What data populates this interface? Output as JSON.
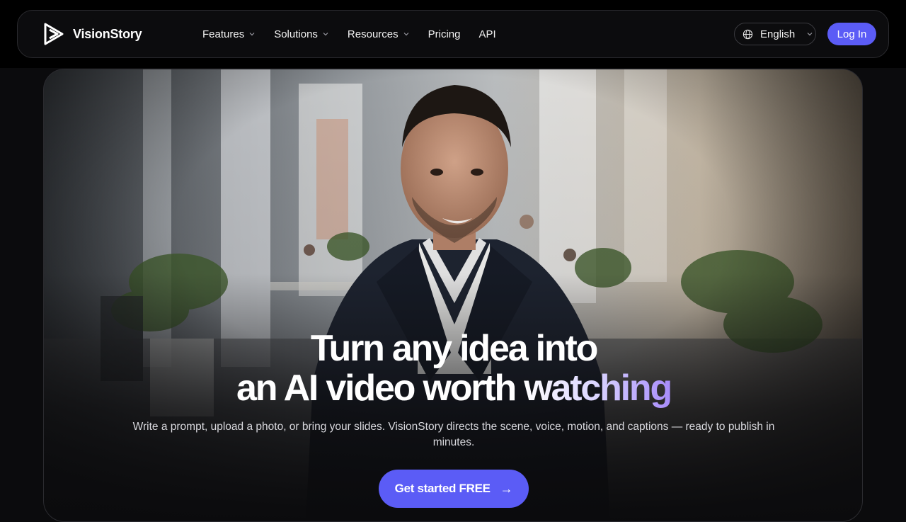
{
  "brand": {
    "name": "VisionStory",
    "logo_icon": "play-triangle-logo"
  },
  "nav": {
    "items": [
      {
        "label": "Features",
        "has_dropdown": true
      },
      {
        "label": "Solutions",
        "has_dropdown": true
      },
      {
        "label": "Resources",
        "has_dropdown": true
      },
      {
        "label": "Pricing",
        "has_dropdown": false
      },
      {
        "label": "API",
        "has_dropdown": false
      }
    ]
  },
  "language": {
    "label": "English",
    "icon": "globe-icon"
  },
  "auth": {
    "login_label": "Log In"
  },
  "hero": {
    "headline_line1": "Turn any idea into",
    "headline_line2_white": "an AI video worth ",
    "headline_line2_accent": "watching",
    "subtitle": "Write a prompt, upload a photo, or bring your slides. VisionStory directs the scene, voice, motion, and captions — ready to publish in minutes.",
    "cta_label": "Get started FREE",
    "cta_arrow": "→",
    "background": "office-presenter-video"
  },
  "colors": {
    "accent": "#5b5cf6",
    "headline_gradient_end": "#a78bfa",
    "page_bg": "#0b0b0d"
  }
}
